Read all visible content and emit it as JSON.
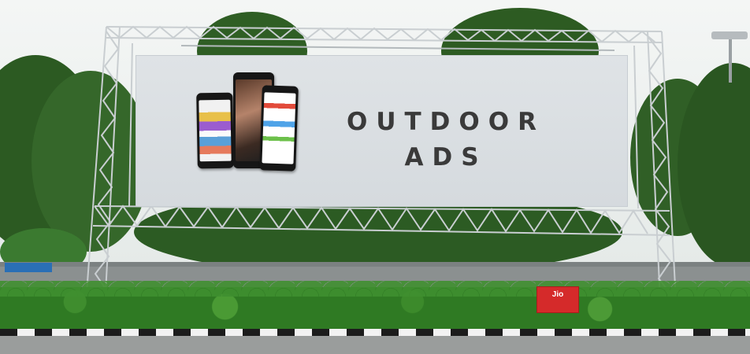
{
  "billboard": {
    "headline_line1": "OUTDOOR",
    "headline_line2": "ADS"
  },
  "signage": {
    "red_box_brand": "Jio"
  },
  "colors": {
    "billboard_face": "#d9dee2",
    "headline": "#3a3a3a",
    "truss": "#c9ced1",
    "foliage": "#2f6d24",
    "hedge": "#2f7a23",
    "curb_dark": "#1c1c1c",
    "curb_light": "#f2f2f2"
  }
}
